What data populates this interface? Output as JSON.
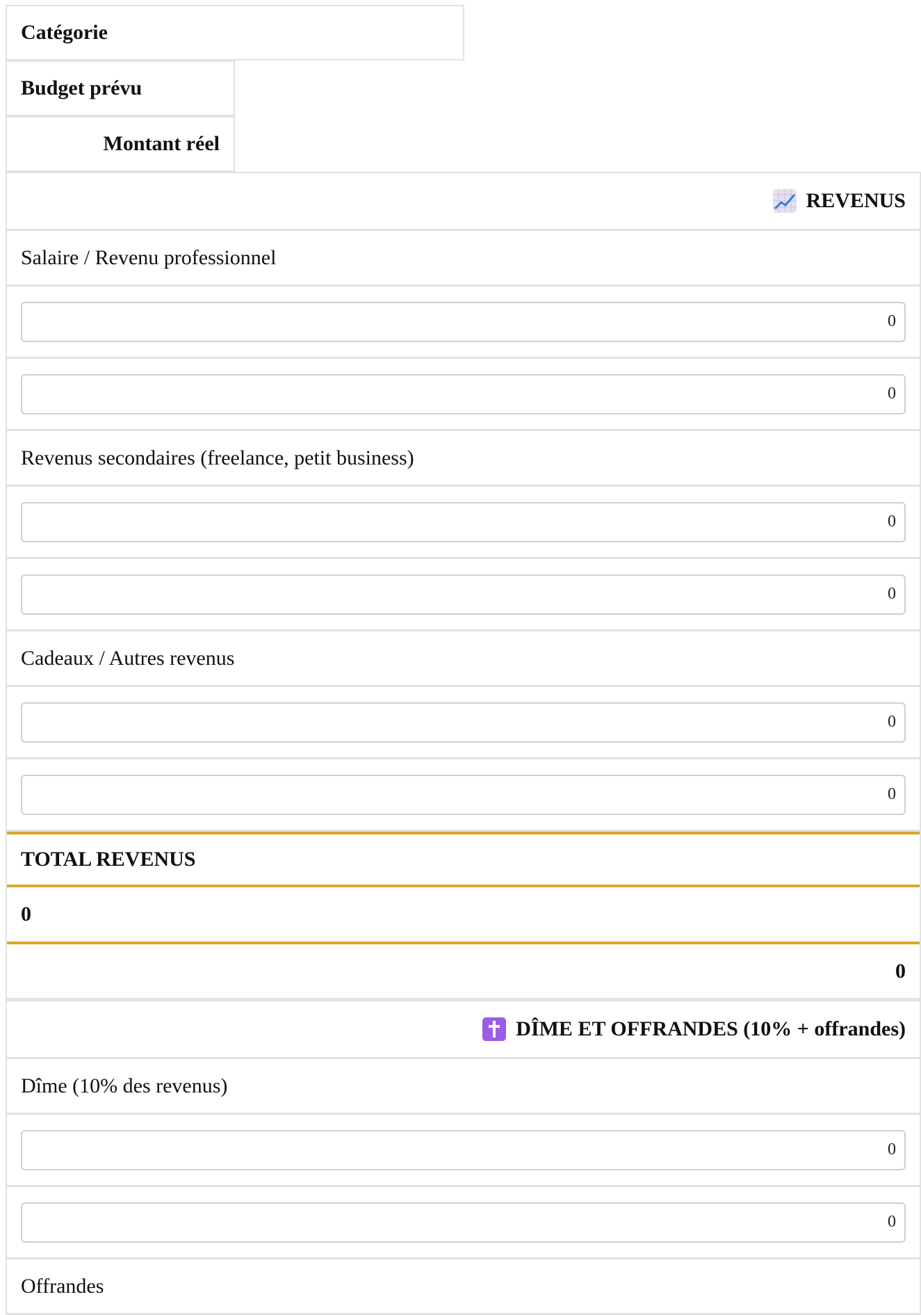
{
  "header": {
    "category": "Catégorie",
    "budget": "Budget prévu",
    "actual": "Montant réel"
  },
  "revenus": {
    "section_title": "REVENUS",
    "section_icon": "chart-increasing-icon",
    "items": [
      {
        "label": "Salaire / Revenu professionnel",
        "budget": "0",
        "actual": "0"
      },
      {
        "label": "Revenus secondaires (freelance, petit business)",
        "budget": "0",
        "actual": "0"
      },
      {
        "label": "Cadeaux / Autres revenus",
        "budget": "0",
        "actual": "0"
      }
    ],
    "total_label": "TOTAL REVENUS",
    "total_budget": "0",
    "total_actual": "0"
  },
  "dime": {
    "section_title": "DÎME ET OFFRANDES (10% + offrandes)",
    "section_icon": "latin-cross-icon",
    "items": [
      {
        "label": "Dîme (10% des revenus)",
        "budget": "0",
        "actual": "0"
      },
      {
        "label": "Offrandes"
      }
    ]
  },
  "colors": {
    "total_accent": "#d9a62e",
    "border": "#e2e2e2",
    "cross_icon_bg": "#9b5de5"
  }
}
